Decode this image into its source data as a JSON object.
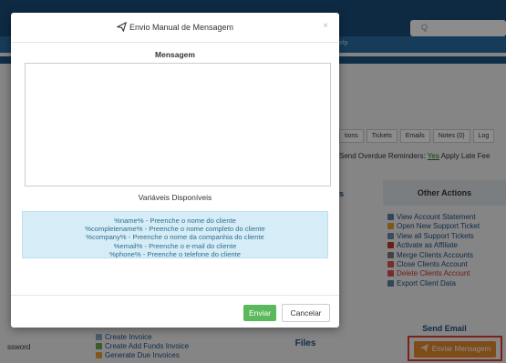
{
  "background": {
    "help_tab": "elp",
    "search_placeholder": "Q",
    "tabs": [
      "tions",
      "Tickets",
      "Emails",
      "Notes (0)",
      "Log"
    ],
    "reminders": {
      "prefix": "Send Overdue Reminders:",
      "value": "Yes",
      "suffix": "Apply Late Fee"
    },
    "column_head": "s",
    "other_actions": {
      "title": "Other Actions",
      "items": [
        {
          "label": "View Account Statement",
          "icon": "document-icon",
          "color": "#5b7fa6"
        },
        {
          "label": "Open New Support Ticket",
          "icon": "ticket-icon",
          "color": "#e3a12f"
        },
        {
          "label": "View all Support Tickets",
          "icon": "list-icon",
          "color": "#6a8caf"
        },
        {
          "label": "Activate as Affiliate",
          "icon": "user-icon",
          "color": "#c0392b"
        },
        {
          "label": "Merge Clients Accounts",
          "icon": "merge-icon",
          "color": "#7a7a7a"
        },
        {
          "label": "Close Clients Account",
          "icon": "close-circle-icon",
          "color": "#d9534f",
          "red": false
        },
        {
          "label": "Delete Clients Account",
          "icon": "delete-icon",
          "color": "#d9534f",
          "red": true
        },
        {
          "label": "Export Client Data",
          "icon": "export-icon",
          "color": "#5b7fa6"
        }
      ]
    },
    "send_email": {
      "title": "Send Email",
      "button": "Enviar Mensagem"
    },
    "files_title": "Files",
    "left_password": "ssword",
    "invoice_actions": [
      "Create Invoice",
      "Create Add Funds Invoice",
      "Generate Due Invoices"
    ]
  },
  "modal": {
    "title": "Envio Manual de Mensagem",
    "close": "×",
    "message_label": "Mensagem",
    "message_value": "",
    "variables_label": "Variáveis Disponíveis",
    "variables": [
      "%name% - Preenche o nome do cliente",
      "%completename% - Preenche o nome completo do cliente",
      "%company% - Preenche o nome da companhia do cliente",
      "%email% - Preenche o e-mail do cliente",
      "%phone% - Preenche o telefone do cliente"
    ],
    "send_button": "Enviar",
    "cancel_button": "Cancelar"
  },
  "colors": {
    "send_button": "#5cb85c",
    "enviar_mensagem": "#e58a2c",
    "highlight_border": "#e23c2c",
    "variables_bg": "#d6ecf7",
    "variables_text": "#31708f"
  }
}
